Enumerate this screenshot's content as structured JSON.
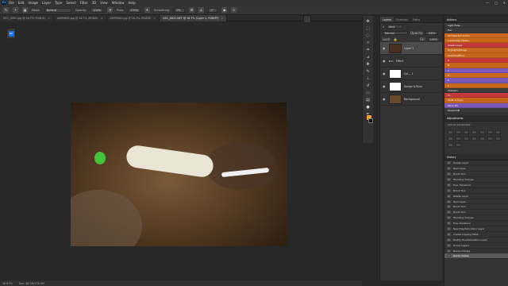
{
  "menubar": {
    "logo": "Ps",
    "items": [
      "File",
      "Edit",
      "Image",
      "Layer",
      "Type",
      "Select",
      "Filter",
      "3D",
      "View",
      "Window",
      "Help"
    ],
    "controls": [
      "—",
      "□",
      "✕"
    ]
  },
  "options": {
    "mode_label": "Mode:",
    "mode_value": "Normal",
    "opacity_label": "Opacity:",
    "opacity_value": "100%",
    "flow_label": "Flow:",
    "flow_value": "100%",
    "smoothing_label": "Smoothing:",
    "smoothing_value": "0%",
    "angle_value": "0°"
  },
  "tabs": [
    {
      "label": "DSC_5091.jpg @ 16.7% (RGB/8)",
      "active": false
    },
    {
      "label": "AMPHIKIS.jpg @ 16.7% (RGB/8)",
      "active": false
    },
    {
      "label": "AMPHIKIS.jpg @ 16.7% (RGB/8)",
      "active": false
    },
    {
      "label": "DSC_6822.NEF @ 16.7% (Layer 2, RGB/8*)",
      "active": true
    }
  ],
  "tool_badge": "BA",
  "status": {
    "zoom": "16.67%",
    "doc": "Doc: 46.2M/176.0M"
  },
  "layers": {
    "tabs": [
      "Layers",
      "Channels",
      "Paths"
    ],
    "kind_label": "Kind",
    "blend_mode": "Normal",
    "opacity_label": "Opacity:",
    "opacity_value": "100%",
    "lock_label": "Lock:",
    "fill_label": "Fill:",
    "fill_value": "100%",
    "items": [
      {
        "name": "Layer 1",
        "selected": true,
        "thumb": "#4a3020"
      },
      {
        "name": "Effect",
        "selected": false,
        "thumb": "#2e2e2e"
      },
      {
        "name": "Col... 1",
        "selected": false,
        "thumb": "#ffffff"
      },
      {
        "name": "Dodge & Burn",
        "selected": false,
        "thumb": "#ffffff"
      },
      {
        "name": "Background",
        "selected": false,
        "thumb": "#6a4a2c"
      }
    ]
  },
  "actions": {
    "title": "Actions",
    "items": [
      {
        "label": "Light Fade",
        "color": "#3a3a3a"
      },
      {
        "label": "Fun",
        "color": "#3a3a3a"
      },
      {
        "label": "All Selected Action",
        "color": "#c8661b"
      },
      {
        "label": "Luminosity Masks",
        "color": "#c8661b"
      },
      {
        "label": "Check Layer",
        "color": "#c43a3a"
      },
      {
        "label": "Highlight/Dodge",
        "color": "#c8661b"
      },
      {
        "label": "Shadows/Burn",
        "color": "#c8661b"
      },
      {
        "label": "A",
        "color": "#c43a3a"
      },
      {
        "label": "B",
        "color": "#c8661b"
      },
      {
        "label": "C",
        "color": "#7a59b6"
      },
      {
        "label": "D",
        "color": "#c8661b"
      },
      {
        "label": "E",
        "color": "#7a59b6"
      },
      {
        "label": "F",
        "color": "#c8661b"
      },
      {
        "label": "Sharpen",
        "color": "#3a3a3a"
      },
      {
        "label": "F1",
        "color": "#c43a3a"
      },
      {
        "label": "Teeth & Eyes",
        "color": "#c8661b"
      },
      {
        "label": "Micro BT",
        "color": "#7a59b6"
      },
      {
        "label": "Global DB",
        "color": "#3a3a3a"
      }
    ]
  },
  "adjustments": {
    "title": "Adjustments",
    "subtitle": "Add an adjustment"
  },
  "history": {
    "title": "History",
    "items": [
      "Delete Layer",
      "New Layer",
      "Brush Tool",
      "Blending Change",
      "Free Transform",
      "Brush Tool",
      "Delete Layer",
      "New Layer",
      "Brush Tool",
      "Brush Tool",
      "Blending Change",
      "Free Transform",
      "New Hue/Saturation Layer",
      "Create Clipping Mask",
      "Modify Hue/Saturation Layer",
      "Group Layers",
      "Name Change",
      "Name Visible"
    ]
  },
  "colors": {
    "foreground": "#f2a22e",
    "background": "#111111",
    "accent": "#1473e6"
  }
}
